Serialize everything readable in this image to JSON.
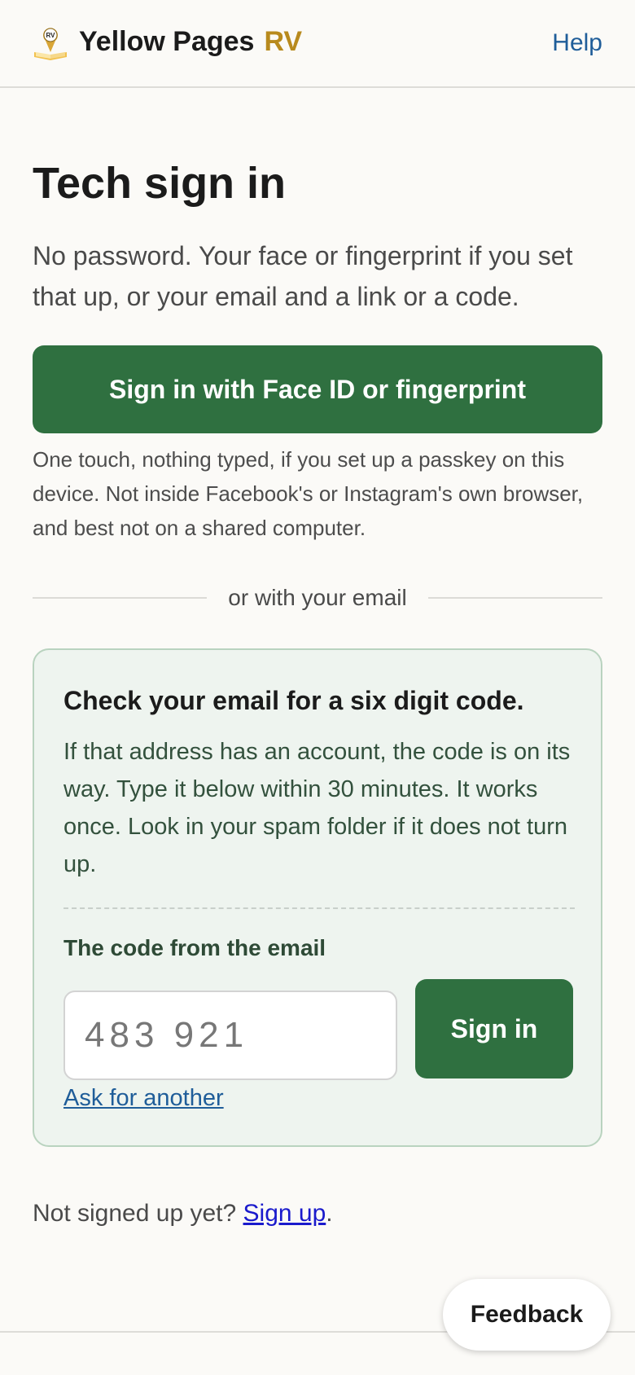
{
  "header": {
    "logo_label": "RV",
    "brand_name": "Yellow Pages",
    "brand_suffix": "RV",
    "help_label": "Help"
  },
  "main": {
    "title": "Tech sign in",
    "intro": "No password. Your face or fingerprint if you set that up, or your email and a link or a code.",
    "passkey_button": "Sign in with Face ID or fingerprint",
    "passkey_note": "One touch, nothing typed, if you set up a passkey on this device. Not inside Facebook's or Instagram's own browser, and best not on a shared computer.",
    "divider_text": "or with your email"
  },
  "code_panel": {
    "title": "Check your email for a six digit code.",
    "body": "If that address has an account, the code is on its way. Type it below within 30 minutes. It works once. Look in your spam folder if it does not turn up.",
    "code_label": "The code from the email",
    "code_placeholder": "483 921",
    "signin_button": "Sign in",
    "ask_link": "Ask for another"
  },
  "signup": {
    "prompt": "Not signed up yet?",
    "link": "Sign up",
    "suffix": "."
  },
  "feedback_label": "Feedback",
  "colors": {
    "accent_green": "#2f7040",
    "brand_gold": "#b88a1d",
    "link_blue": "#1f5d99",
    "panel_bg": "#eef4ef"
  }
}
